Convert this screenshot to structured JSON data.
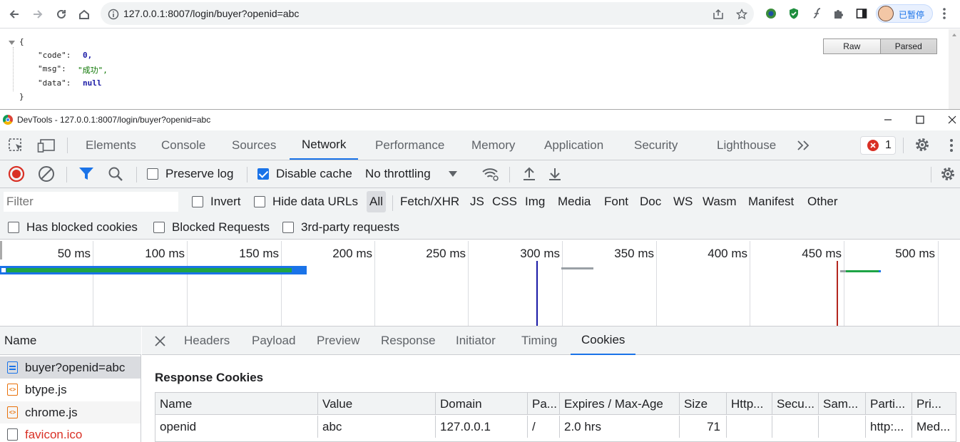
{
  "browser": {
    "url": "127.0.0.1:8007/login/buyer?openid=abc",
    "profile_name": "已暂停"
  },
  "page": {
    "view_buttons": {
      "raw": "Raw",
      "parsed": "Parsed",
      "active": "Parsed"
    },
    "json": {
      "open_brace": "{",
      "close_brace": "}",
      "code_key": "\"code\":",
      "code_val": "0,",
      "msg_key": "\"msg\":",
      "msg_val": "\"成功\",",
      "data_key": "\"data\":",
      "data_val": "null"
    }
  },
  "devtools": {
    "title": "DevTools - 127.0.0.1:8007/login/buyer?openid=abc",
    "tabs": [
      "Elements",
      "Console",
      "Sources",
      "Network",
      "Performance",
      "Memory",
      "Application",
      "Security",
      "Lighthouse"
    ],
    "active_tab": "Network",
    "error_count": "1",
    "toolbar": {
      "preserve_log": "Preserve log",
      "preserve_log_checked": false,
      "disable_cache": "Disable cache",
      "disable_cache_checked": true,
      "throttling": "No throttling"
    },
    "filter": {
      "placeholder": "Filter",
      "invert": "Invert",
      "hide_data_urls": "Hide data URLs",
      "types": [
        "All",
        "Fetch/XHR",
        "JS",
        "CSS",
        "Img",
        "Media",
        "Font",
        "Doc",
        "WS",
        "Wasm",
        "Manifest",
        "Other"
      ],
      "active_type": "All",
      "has_blocked_cookies": "Has blocked cookies",
      "blocked_requests": "Blocked Requests",
      "third_party": "3rd-party requests"
    },
    "timeline": {
      "ticks": [
        "50 ms",
        "100 ms",
        "150 ms",
        "200 ms",
        "250 ms",
        "300 ms",
        "350 ms",
        "400 ms",
        "450 ms",
        "500 ms"
      ]
    },
    "requests": {
      "header": "Name",
      "items": [
        {
          "name": "buyer?openid=abc",
          "type": "doc",
          "color": "#202124"
        },
        {
          "name": "btype.js",
          "type": "script",
          "color": "#202124"
        },
        {
          "name": "chrome.js",
          "type": "script",
          "color": "#202124"
        },
        {
          "name": "favicon.ico",
          "type": "plain",
          "color": "#d93025"
        }
      ]
    },
    "detail": {
      "tabs": [
        "Headers",
        "Payload",
        "Preview",
        "Response",
        "Initiator",
        "Timing",
        "Cookies"
      ],
      "active_tab": "Cookies",
      "section_title": "Response Cookies",
      "columns": [
        "Name",
        "Value",
        "Domain",
        "Pa...",
        "Expires / Max-Age",
        "Size",
        "Http...",
        "Secu...",
        "Sam...",
        "Parti...",
        "Pri..."
      ],
      "rows": [
        [
          "openid",
          "abc",
          "127.0.0.1",
          "/",
          "2.0 hrs",
          "71",
          "",
          "",
          "",
          "http:...",
          "Med..."
        ]
      ]
    }
  },
  "colors": {
    "accent": "#1a73e8",
    "record_red": "#d93025",
    "bar_green": "#1ea446",
    "bar_blue": "#1a73e8",
    "error_red": "#d93025"
  }
}
